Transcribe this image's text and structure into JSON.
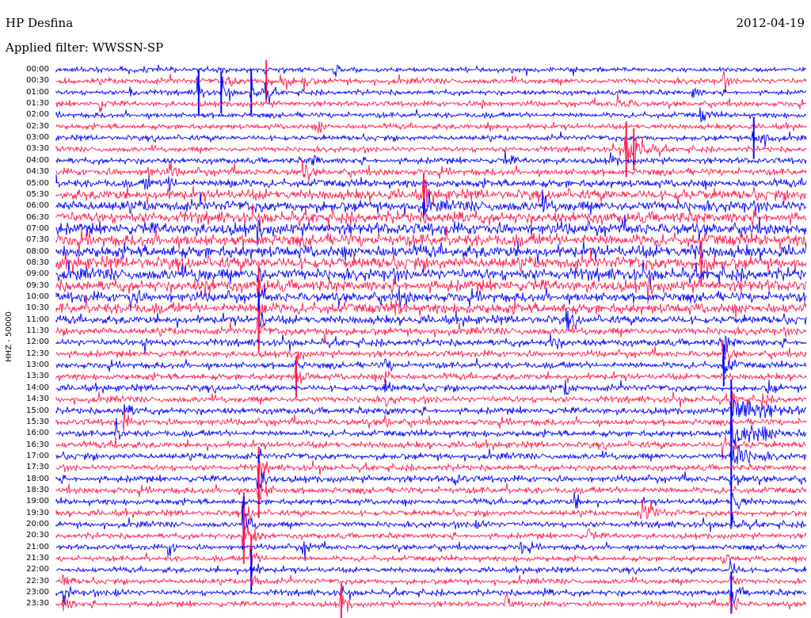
{
  "header": {
    "station": "HP Desfina",
    "date": "2012-04-19",
    "filter_prefix": "Applied filter:",
    "filter_name": "WWSSN-SP"
  },
  "axis": {
    "channel": "HHZ - 50000"
  },
  "rows": [
    {
      "time": "00:00",
      "color": "blue",
      "noise": 0.25,
      "events": [
        [
          0.37,
          0.8,
          3
        ]
      ]
    },
    {
      "time": "00:30",
      "color": "red",
      "noise": 0.35,
      "events": [
        [
          0.23,
          0.6,
          5
        ],
        [
          0.28,
          1.2,
          4
        ],
        [
          0.3,
          1.0,
          6
        ],
        [
          0.33,
          1.0,
          4
        ],
        [
          0.89,
          0.8,
          4
        ]
      ]
    },
    {
      "time": "01:00",
      "color": "blue",
      "noise": 0.25,
      "events": [
        [
          0.1,
          0.9,
          3
        ],
        [
          0.19,
          1.3,
          4
        ],
        [
          0.22,
          1.2,
          5
        ],
        [
          0.26,
          1.3,
          6
        ],
        [
          0.28,
          1.0,
          4
        ],
        [
          0.85,
          0.7,
          4
        ]
      ]
    },
    {
      "time": "01:30",
      "color": "red",
      "noise": 0.3,
      "events": [
        [
          0.06,
          0.7,
          3
        ],
        [
          0.57,
          0.7,
          4
        ],
        [
          0.75,
          0.9,
          8
        ]
      ]
    },
    {
      "time": "02:00",
      "color": "blue",
      "noise": 0.3,
      "events": [
        [
          0.86,
          0.9,
          5
        ]
      ]
    },
    {
      "time": "02:30",
      "color": "red",
      "noise": 0.3,
      "events": [
        [
          0.35,
          0.8,
          4
        ],
        [
          0.58,
          0.6,
          3
        ]
      ]
    },
    {
      "time": "03:00",
      "color": "blue",
      "noise": 0.3,
      "events": [
        [
          0.93,
          1.2,
          10
        ]
      ]
    },
    {
      "time": "03:30",
      "color": "red",
      "noise": 0.3,
      "events": [
        [
          0.76,
          1.6,
          12
        ],
        [
          0.77,
          1.2,
          10
        ]
      ]
    },
    {
      "time": "04:00",
      "color": "blue",
      "noise": 0.35,
      "events": [
        [
          0.34,
          0.9,
          6
        ],
        [
          0.6,
          0.7,
          5
        ],
        [
          0.74,
          0.6,
          4
        ]
      ]
    },
    {
      "time": "04:30",
      "color": "red",
      "noise": 0.45,
      "events": [
        [
          0.12,
          0.9,
          4
        ],
        [
          0.15,
          1.0,
          4
        ],
        [
          0.33,
          0.8,
          5
        ]
      ]
    },
    {
      "time": "05:00",
      "color": "blue",
      "noise": 0.55,
      "events": [
        [
          0.12,
          0.8,
          3
        ],
        [
          0.15,
          1.0,
          4
        ],
        [
          0.23,
          0.7,
          5
        ]
      ]
    },
    {
      "time": "05:30",
      "color": "red",
      "noise": 0.8,
      "events": [
        [
          0.49,
          1.2,
          4
        ],
        [
          0.83,
          1.0,
          3
        ]
      ]
    },
    {
      "time": "06:00",
      "color": "blue",
      "noise": 0.85,
      "events": [
        [
          0.49,
          0.9,
          4
        ],
        [
          0.65,
          0.7,
          4
        ]
      ]
    },
    {
      "time": "06:30",
      "color": "red",
      "noise": 0.9,
      "events": [
        [
          0.53,
          0.9,
          4
        ]
      ]
    },
    {
      "time": "07:00",
      "color": "blue",
      "noise": 0.95,
      "events": [
        [
          0.27,
          0.7,
          4
        ]
      ]
    },
    {
      "time": "07:30",
      "color": "red",
      "noise": 1.0,
      "events": []
    },
    {
      "time": "08:00",
      "color": "blue",
      "noise": 1.0,
      "events": [
        [
          0.85,
          0.8,
          4
        ]
      ]
    },
    {
      "time": "08:30",
      "color": "red",
      "noise": 1.0,
      "events": [
        [
          0.86,
          1.2,
          6
        ]
      ]
    },
    {
      "time": "09:00",
      "color": "blue",
      "noise": 0.95,
      "events": [
        [
          0.19,
          0.8,
          4
        ],
        [
          0.27,
          0.9,
          4
        ]
      ]
    },
    {
      "time": "09:30",
      "color": "red",
      "noise": 0.9,
      "events": [
        [
          0.2,
          1.0,
          4
        ],
        [
          0.27,
          1.2,
          4
        ],
        [
          0.79,
          0.8,
          4
        ]
      ]
    },
    {
      "time": "10:00",
      "color": "blue",
      "noise": 0.75,
      "events": [
        [
          0.1,
          1.0,
          4
        ],
        [
          0.46,
          0.8,
          5
        ]
      ]
    },
    {
      "time": "10:30",
      "color": "red",
      "noise": 0.85,
      "events": [
        [
          0.27,
          1.4,
          5
        ],
        [
          0.45,
          0.8,
          5
        ]
      ]
    },
    {
      "time": "11:00",
      "color": "blue",
      "noise": 0.6,
      "events": [
        [
          0.27,
          1.6,
          4
        ],
        [
          0.68,
          0.9,
          5
        ]
      ]
    },
    {
      "time": "11:30",
      "color": "red",
      "noise": 0.5,
      "events": [
        [
          0.27,
          1.2,
          4
        ],
        [
          0.36,
          0.8,
          3
        ]
      ]
    },
    {
      "time": "12:00",
      "color": "blue",
      "noise": 0.45,
      "events": [
        [
          0.12,
          0.7,
          4
        ],
        [
          0.66,
          1.0,
          5
        ],
        [
          0.89,
          1.1,
          6
        ]
      ]
    },
    {
      "time": "12:30",
      "color": "red",
      "noise": 0.4,
      "events": [
        [
          0.32,
          0.8,
          4
        ],
        [
          0.89,
          1.0,
          5
        ]
      ]
    },
    {
      "time": "13:00",
      "color": "blue",
      "noise": 0.4,
      "events": [
        [
          0.32,
          0.8,
          3
        ],
        [
          0.44,
          0.7,
          4
        ],
        [
          0.89,
          1.2,
          6
        ]
      ]
    },
    {
      "time": "13:30",
      "color": "red",
      "noise": 0.4,
      "events": [
        [
          0.32,
          1.2,
          6
        ],
        [
          0.44,
          0.8,
          4
        ]
      ]
    },
    {
      "time": "14:00",
      "color": "blue",
      "noise": 0.4,
      "events": [
        [
          0.44,
          0.8,
          4
        ],
        [
          0.68,
          0.7,
          4
        ],
        [
          0.95,
          0.8,
          4
        ]
      ]
    },
    {
      "time": "14:30",
      "color": "red",
      "noise": 0.4,
      "events": [
        [
          0.44,
          0.9,
          4
        ],
        [
          0.9,
          1.0,
          5
        ],
        [
          0.94,
          0.9,
          4
        ]
      ]
    },
    {
      "time": "15:00",
      "color": "blue",
      "noise": 0.4,
      "events": [
        [
          0.09,
          1.1,
          6
        ],
        [
          0.44,
          0.7,
          4
        ],
        [
          0.9,
          1.8,
          25
        ]
      ]
    },
    {
      "time": "15:30",
      "color": "red",
      "noise": 0.4,
      "events": [
        [
          0.09,
          0.9,
          4
        ],
        [
          0.44,
          0.6,
          3
        ]
      ]
    },
    {
      "time": "16:00",
      "color": "blue",
      "noise": 0.4,
      "events": [
        [
          0.08,
          0.9,
          4
        ],
        [
          0.9,
          1.6,
          25
        ]
      ]
    },
    {
      "time": "16:30",
      "color": "red",
      "noise": 0.4,
      "events": [
        [
          0.08,
          0.7,
          4
        ],
        [
          0.89,
          1.0,
          10
        ]
      ]
    },
    {
      "time": "17:00",
      "color": "blue",
      "noise": 0.4,
      "events": [
        [
          0.9,
          1.4,
          16
        ]
      ]
    },
    {
      "time": "17:30",
      "color": "red",
      "noise": 0.35,
      "events": [
        [
          0.27,
          1.2,
          5
        ]
      ]
    },
    {
      "time": "18:00",
      "color": "blue",
      "noise": 0.4,
      "events": [
        [
          0.27,
          1.4,
          6
        ],
        [
          0.53,
          0.9,
          5
        ],
        [
          0.9,
          1.0,
          6
        ]
      ]
    },
    {
      "time": "18:30",
      "color": "red",
      "noise": 0.4,
      "events": [
        [
          0.27,
          1.6,
          6
        ]
      ]
    },
    {
      "time": "19:00",
      "color": "blue",
      "noise": 0.35,
      "events": [
        [
          0.69,
          0.9,
          5
        ],
        [
          0.9,
          1.4,
          8
        ]
      ]
    },
    {
      "time": "19:30",
      "color": "red",
      "noise": 0.35,
      "events": [
        [
          0.25,
          1.2,
          6
        ],
        [
          0.78,
          1.0,
          12
        ]
      ]
    },
    {
      "time": "20:00",
      "color": "blue",
      "noise": 0.35,
      "events": [
        [
          0.25,
          1.6,
          6
        ],
        [
          0.56,
          1.0,
          5
        ],
        [
          0.9,
          1.0,
          6
        ]
      ]
    },
    {
      "time": "20:30",
      "color": "red",
      "noise": 0.3,
      "events": [
        [
          0.25,
          1.6,
          8
        ],
        [
          0.71,
          0.7,
          4
        ]
      ]
    },
    {
      "time": "21:00",
      "color": "blue",
      "noise": 0.3,
      "events": [
        [
          0.15,
          0.8,
          5
        ],
        [
          0.33,
          1.0,
          5
        ],
        [
          0.62,
          0.7,
          4
        ]
      ]
    },
    {
      "time": "21:30",
      "color": "red",
      "noise": 0.3,
      "events": [
        [
          0.26,
          1.4,
          5
        ],
        [
          0.89,
          0.8,
          4
        ]
      ]
    },
    {
      "time": "22:00",
      "color": "blue",
      "noise": 0.3,
      "events": [
        [
          0.26,
          1.2,
          5
        ],
        [
          0.9,
          1.0,
          5
        ]
      ]
    },
    {
      "time": "22:30",
      "color": "red",
      "noise": 0.3,
      "events": [
        [
          0.01,
          0.9,
          5
        ],
        [
          0.26,
          1.1,
          5
        ],
        [
          0.9,
          0.9,
          4
        ]
      ]
    },
    {
      "time": "23:00",
      "color": "blue",
      "noise": 0.35,
      "events": [
        [
          0.01,
          1.0,
          5
        ],
        [
          0.08,
          0.8,
          4
        ],
        [
          0.65,
          0.9,
          4
        ],
        [
          0.9,
          1.2,
          6
        ]
      ]
    },
    {
      "time": "23:30",
      "color": "red",
      "noise": 0.3,
      "events": [
        [
          0.01,
          1.0,
          5
        ],
        [
          0.38,
          1.2,
          5
        ],
        [
          0.6,
          0.8,
          4
        ],
        [
          0.9,
          1.1,
          6
        ]
      ]
    }
  ],
  "colors": {
    "blue": "#0000ff",
    "red": "#ff1a4d",
    "background": "#ffffff",
    "text": "#000000"
  }
}
